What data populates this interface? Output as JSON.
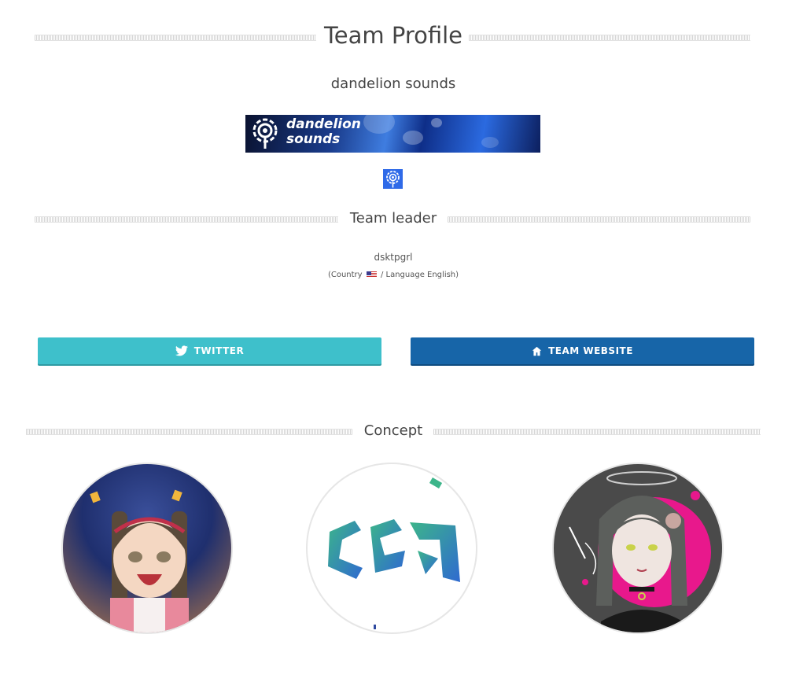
{
  "page": {
    "title": "Team Profile",
    "team_name": "dandelion sounds"
  },
  "banner": {
    "text_line1": "dandelion",
    "text_line2": "sounds"
  },
  "leader": {
    "heading": "Team leader",
    "name": "dsktpgrl",
    "meta_prefix": "(Country",
    "meta_suffix": "/ Language English)",
    "country_flag": "us-flag-icon"
  },
  "buttons": {
    "twitter_label": "TWITTER",
    "website_label": "TEAM WEBSITE"
  },
  "concept": {
    "heading": "Concept",
    "avatars": [
      "character-avatar",
      "logo-avatar",
      "girl-illustration-avatar"
    ]
  },
  "colors": {
    "twitter_button": "#3ec0cb",
    "website_button": "#1765a8",
    "heading_text": "#444444",
    "team_icon_bg": "#2f6ae8"
  }
}
